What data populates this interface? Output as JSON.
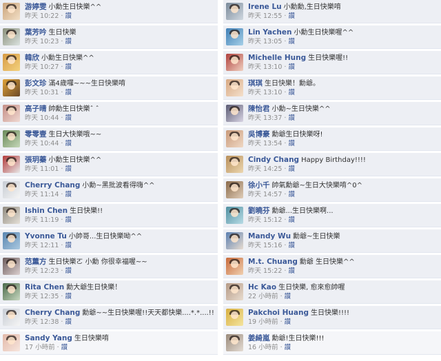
{
  "like_label": "讚",
  "sep": " · ",
  "left": [
    {
      "name": "游婷雯",
      "msg": "小勳生日快樂^^",
      "time": "昨天 10:22",
      "colors": [
        "#c9a37b",
        "#f2dfc6"
      ]
    },
    {
      "name": "葉芳吟",
      "msg": "生日快樂",
      "time": "昨天 10:23",
      "colors": [
        "#8a8f7a",
        "#dbe3e0"
      ]
    },
    {
      "name": "韓欣",
      "msg": "小勳生日快樂^^",
      "time": "昨天 10:27",
      "colors": [
        "#d69a45",
        "#f4d27e"
      ]
    },
    {
      "name": "彭文珍",
      "msg": "滿4歲囉~~~生日快樂唷",
      "time": "昨天 10:31",
      "colors": [
        "#e0a236",
        "#6b4a2a"
      ]
    },
    {
      "name": "高子晴",
      "msg": "帥勳生日快樂ˆ ˆ",
      "time": "昨天 10:44",
      "colors": [
        "#c48e86",
        "#f0d9d2"
      ]
    },
    {
      "name": "零零壹",
      "msg": "生日大快樂哦~~",
      "time": "昨天 10:44",
      "colors": [
        "#6c8a5a",
        "#c4d7b8"
      ]
    },
    {
      "name": "張玥蓁",
      "msg": "小勳生日快樂^^",
      "time": "昨天 11:01",
      "colors": [
        "#b23a3a",
        "#e8e8e8"
      ]
    },
    {
      "name": "Cherry Chang",
      "msg": "小勳~黑批波看得嗨^^",
      "time": "昨天 11:14",
      "colors": [
        "#c7ccd4",
        "#f5f5f5"
      ]
    },
    {
      "name": "Ishin Chen",
      "msg": "生日快樂!!",
      "time": "昨天 11:19",
      "colors": [
        "#8f8a80",
        "#e6e1d8"
      ]
    },
    {
      "name": "Yvonne Tu",
      "msg": "小帥哥...生日快樂呦^^",
      "time": "昨天 12:11",
      "colors": [
        "#5a86b0",
        "#a9c8e0"
      ]
    },
    {
      "name": "范薰方",
      "msg": "生日快樂ㄛ 小勳 你很幸福喔~~",
      "time": "昨天 12:23",
      "colors": [
        "#6b5b5b",
        "#dcd0d0"
      ]
    },
    {
      "name": "Rita Chen",
      "msg": "勳大爺生日快樂！",
      "time": "昨天 12:35",
      "colors": [
        "#4a6a4a",
        "#c8d8c0"
      ]
    },
    {
      "name": "Cherry Chang",
      "msg": "勳爺~~生日快樂喔!!天天都快樂....*.*....!!",
      "time": "昨天 12:38",
      "colors": [
        "#c7ccd4",
        "#f5f5f5"
      ]
    },
    {
      "name": "Sandy Yang",
      "msg": "生日快樂唷",
      "time": "17 小時前",
      "colors": [
        "#e2b8a8",
        "#f7e6de"
      ]
    }
  ],
  "right": [
    {
      "name": "Irene Lu",
      "msg": "小勳勳,生日快樂唷",
      "time": "昨天 12:55",
      "colors": [
        "#7a8a9a",
        "#d0d8e0"
      ]
    },
    {
      "name": "Lin Yachen",
      "msg": "小勳生日快樂喔^^",
      "time": "昨天 13:05",
      "colors": [
        "#3f7fb6",
        "#a6d0e8"
      ]
    },
    {
      "name": "Michelle Hung",
      "msg": "生日快樂喔!!",
      "time": "昨天 13:10",
      "colors": [
        "#b0403c",
        "#f0d0c0"
      ]
    },
    {
      "name": "琪琪",
      "msg": "生日快樂！勳爺。",
      "time": "昨天 13:10",
      "colors": [
        "#d8a982",
        "#f4e0cc"
      ]
    },
    {
      "name": "陳怡君",
      "msg": "小勳~生日快樂^^",
      "time": "昨天 13:37",
      "colors": [
        "#5a5a72",
        "#d8d4e4"
      ]
    },
    {
      "name": "吳博豪",
      "msg": "勳爺生日快樂呀!",
      "time": "昨天 13:54",
      "colors": [
        "#c99a7a",
        "#efd8c4"
      ]
    },
    {
      "name": "Cindy Chang",
      "msg": "Happy Birthday!!!!",
      "time": "昨天 14:25",
      "colors": [
        "#b88f5a",
        "#ecd7b0"
      ]
    },
    {
      "name": "徐小千",
      "msg": "帥氣勳爺~生日大快樂唷^0^",
      "time": "昨天 14:57",
      "colors": [
        "#8a6a4a",
        "#e0cdb8"
      ]
    },
    {
      "name": "劉曉芬",
      "msg": "勳爺...生日快樂啊...",
      "time": "昨天 15:12",
      "colors": [
        "#4f8fa0",
        "#b8dce6"
      ]
    },
    {
      "name": "Mandy Wu",
      "msg": "勳爺~生日快樂",
      "time": "昨天 15:16",
      "colors": [
        "#5a7fb0",
        "#e8dcd0"
      ]
    },
    {
      "name": "M.t. Chuang",
      "msg": "勳爺 生日快樂^^",
      "time": "昨天 15:22",
      "colors": [
        "#c86a3a",
        "#f0d0b0"
      ]
    },
    {
      "name": "Hc Kao",
      "msg": "生日快樂, 愈來愈帥喔",
      "time": "22 小時前",
      "colors": [
        "#b59a86",
        "#e8dccf"
      ]
    },
    {
      "name": "Pakchoi Huang",
      "msg": "生日快樂!!!!",
      "time": "19 小時前",
      "colors": [
        "#d8b040",
        "#f4e4a0"
      ]
    },
    {
      "name": "姜綺嵐",
      "msg": "勳爺!生日快樂!!!",
      "time": "16 小時前",
      "colors": [
        "#9a8a7a",
        "#e4dcd4"
      ]
    }
  ]
}
